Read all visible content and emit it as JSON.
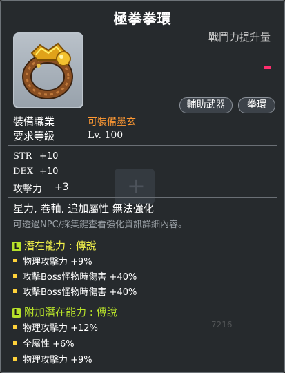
{
  "item": {
    "name": "極拳拳環",
    "power_label": "戰鬥力提升量",
    "tags": [
      "輔助武器",
      "拳環"
    ],
    "job_label": "裝備職業",
    "job_value": "可裝備墨玄",
    "level_label": "要求等級",
    "level_value": "Lv. 100",
    "icon": "spiked-ring-knuckle-icon",
    "colors": {
      "job": "#ff9933",
      "power_dash": "#ff2e6e"
    }
  },
  "stats": [
    {
      "name": "STR",
      "value": "+10"
    },
    {
      "name": "DEX",
      "value": "+10"
    },
    {
      "name": "攻擊力",
      "value": "+3"
    }
  ],
  "flags": "星力, 卷軸, 追加屬性 無法強化",
  "hint": "可透過NPC/採集鍵查看強化資訊詳細內容。",
  "potential": {
    "title": "潛在能力 : 傳說",
    "badge": "L",
    "lines": [
      "物理攻擊力 +9%",
      "攻擊Boss怪物時傷害 +40%",
      "攻擊Boss怪物時傷害 +40%"
    ]
  },
  "bonus_potential": {
    "title": "附加潛在能力 : 傳說",
    "badge": "L",
    "lines": [
      "物理攻擊力 +12%",
      "全屬性 +6%",
      "物理攻擊力 +9%"
    ]
  },
  "background": {
    "faded_number": "7216"
  }
}
